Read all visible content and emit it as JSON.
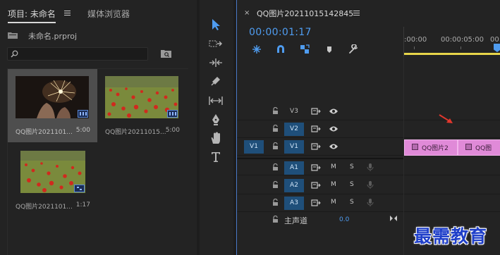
{
  "project_panel": {
    "tab_project": "项目: 未命名",
    "tab_media_browser": "媒体浏览器",
    "project_file": "未命名.prproj",
    "search_placeholder": "",
    "items": [
      {
        "name": "QQ图片2021101...",
        "duration": "5:00",
        "thumb": "sparkler"
      },
      {
        "name": "QQ图片20211015...",
        "duration": "5:00",
        "thumb": "poppies"
      },
      {
        "name": "QQ图片2021101...",
        "duration": "1:17",
        "thumb": "poppies"
      }
    ]
  },
  "tools": [
    "selection-tool",
    "track-select-tool",
    "ripple-edit-tool",
    "razor-tool",
    "slip-tool",
    "pen-tool",
    "hand-tool",
    "type-tool"
  ],
  "timeline": {
    "title": "QQ图片20211015142845",
    "timecode": "00:00:01:17",
    "ruler_labels": [
      ":00:00",
      "00:00:05:00",
      "00:0"
    ],
    "source_patch": "V1",
    "video_tracks": [
      {
        "name": "V3",
        "targeted": false
      },
      {
        "name": "V2",
        "targeted": true
      },
      {
        "name": "V1",
        "targeted": true
      }
    ],
    "audio_tracks": [
      {
        "name": "A1",
        "mute": "M",
        "solo": "S"
      },
      {
        "name": "A2",
        "mute": "M",
        "solo": "S"
      },
      {
        "name": "A3",
        "mute": "M",
        "solo": "S"
      }
    ],
    "master": {
      "label": "主声道",
      "value": "0.0"
    },
    "clips": [
      {
        "label": "QQ图片2"
      },
      {
        "label": "QQ图"
      }
    ]
  },
  "colors": {
    "accent_blue": "#4f9cf0",
    "track_target": "#1f4f7a",
    "clip_pink": "#e08ad8",
    "work_area": "#e7d54a",
    "watermark": "#1f3fc9"
  },
  "watermark": "最需教育"
}
